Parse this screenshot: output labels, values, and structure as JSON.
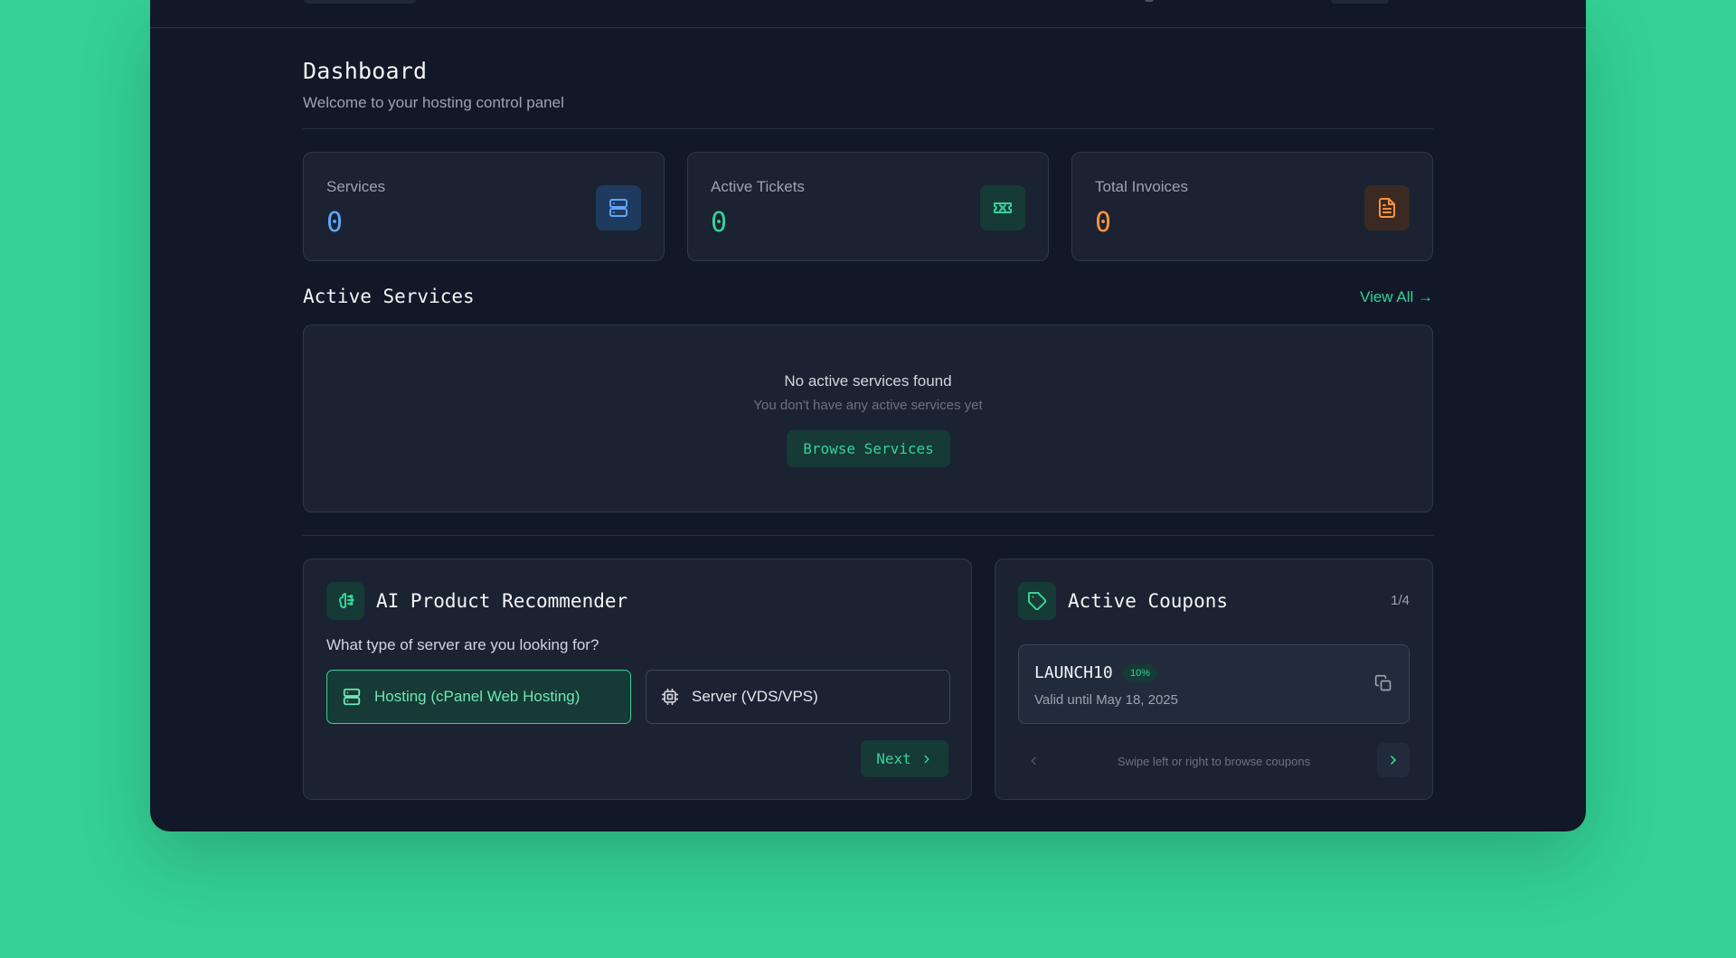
{
  "header": {
    "title": "Dashboard",
    "subtitle": "Welcome to your hosting control panel"
  },
  "stats": [
    {
      "label": "Services",
      "value": "0",
      "color": "#60a5fa",
      "icon": "server-icon"
    },
    {
      "label": "Active Tickets",
      "value": "0",
      "color": "#34d399",
      "icon": "ticket-icon"
    },
    {
      "label": "Total Invoices",
      "value": "0",
      "color": "#fb923c",
      "icon": "invoice-icon"
    }
  ],
  "active_services": {
    "title": "Active Services",
    "view_all": "View All →",
    "empty_title": "No active services found",
    "empty_sub": "You don't have any active services yet",
    "browse_label": "Browse Services"
  },
  "recommender": {
    "title": "AI Product Recommender",
    "icon": "brain-icon",
    "question": "What type of server are you looking for?",
    "options": [
      {
        "label": "Hosting (cPanel Web Hosting)",
        "selected": true,
        "icon": "server-icon"
      },
      {
        "label": "Server (VDS/VPS)",
        "selected": false,
        "icon": "cpu-icon"
      }
    ],
    "next_label": "Next"
  },
  "coupons": {
    "title": "Active Coupons",
    "icon": "tag-icon",
    "counter": "1/4",
    "current": {
      "code": "LAUNCH10",
      "discount": "10%",
      "valid": "Valid until May 18, 2025"
    },
    "hint": "Swipe left or right to browse coupons"
  },
  "colors": {
    "accent": "#34d399",
    "background": "#111827",
    "card": "#1b2232",
    "page_bg": "#34d195"
  }
}
